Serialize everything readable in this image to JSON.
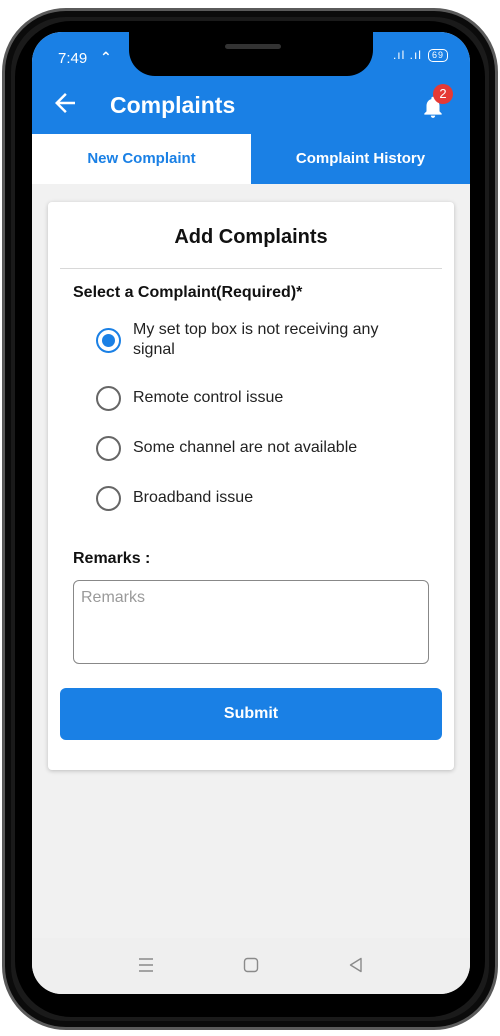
{
  "status_bar": {
    "time": "7:49",
    "signal": ".ıl .ıl",
    "battery": "69"
  },
  "app_bar": {
    "title": "Complaints",
    "notification_count": "2"
  },
  "tabs": [
    {
      "label": "New Complaint",
      "active": true
    },
    {
      "label": "Complaint History",
      "active": false
    }
  ],
  "form": {
    "title": "Add Complaints",
    "select_label": "Select a Complaint(Required)*",
    "options": [
      {
        "label": "My set top box is not receiving any signal",
        "selected": true
      },
      {
        "label": "Remote control issue",
        "selected": false
      },
      {
        "label": "Some channel are not available",
        "selected": false
      },
      {
        "label": "Broadband issue",
        "selected": false
      }
    ],
    "remarks_label": "Remarks :",
    "remarks_placeholder": "Remarks",
    "remarks_value": "",
    "submit_label": "Submit"
  },
  "colors": {
    "primary": "#1a80e5",
    "badge": "#e53935",
    "background": "#f1f1f1"
  },
  "icons": {
    "back": "arrow-left-icon",
    "notifications": "bell-icon",
    "nav": [
      "recents-icon",
      "home-icon",
      "back-triangle-icon"
    ]
  }
}
